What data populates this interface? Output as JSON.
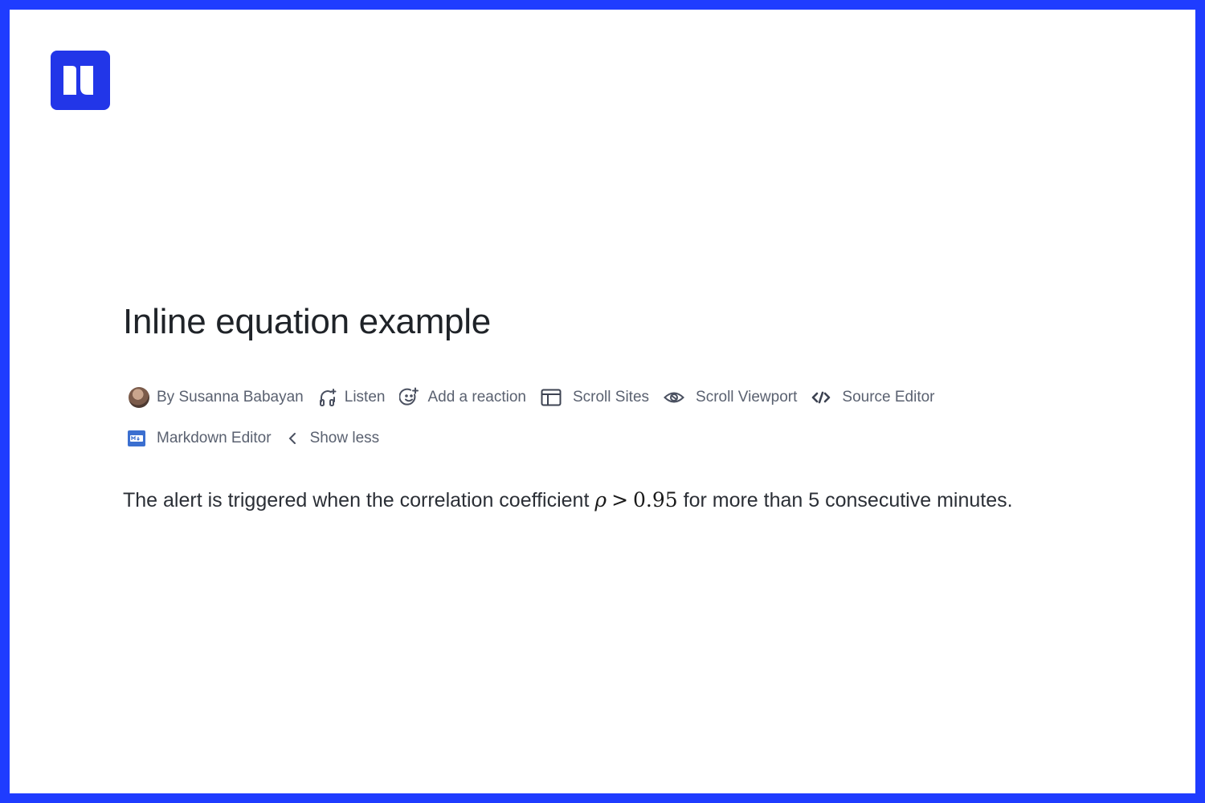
{
  "logo": {
    "icon": "logo-icon"
  },
  "page": {
    "title": "Inline equation example"
  },
  "meta": {
    "author": "By Susanna Babayan",
    "listen": "Listen",
    "reaction": "Add a reaction",
    "scroll_sites": "Scroll Sites",
    "scroll_viewport": "Scroll Viewport",
    "source_editor": "Source Editor",
    "markdown_editor": "Markdown Editor",
    "show_less": "Show less"
  },
  "content": {
    "before": "The alert is triggered when the correlation coefficient ",
    "math_var": "ρ",
    "math_op": ">",
    "math_val": "0.95",
    "after": " for more than 5 consecutive minutes."
  },
  "colors": {
    "border": "#1f3cff",
    "logo_bg": "#2236e8",
    "meta_text": "#5a6170"
  }
}
